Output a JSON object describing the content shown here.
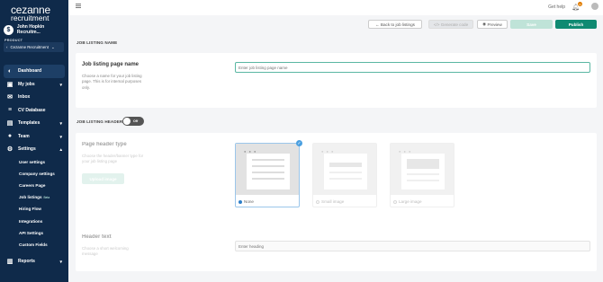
{
  "sidebar": {
    "logo_line1": "cezanne",
    "logo_line2": "recruitment",
    "user_initial": "$",
    "user_name": "John Hopkin Recruitm...",
    "product_label": "PRODUCT",
    "product_value": "Cezanne Recruitment",
    "nav": {
      "dashboard": "Dashboard",
      "my_jobs": "My jobs",
      "inbox": "Inbox",
      "cv_database": "CV Database",
      "templates": "Templates",
      "team": "Team",
      "settings": "Settings",
      "reports": "Reports"
    },
    "settings_sub": {
      "user_settings": "User settings",
      "company_settings": "Company settings",
      "careers_page": "Careers Page",
      "job_listings": "Job listings",
      "job_listings_badge": "Beta",
      "hiring_flow": "Hiring Flow",
      "integrations": "Integrations",
      "api_settings": "API Settings",
      "custom_fields": "Custom Fields"
    }
  },
  "topbar": {
    "get_help": "Get help",
    "notification_count": "N"
  },
  "actions": {
    "back": "Back to job listings",
    "generate": "Generate code",
    "preview": "Preview",
    "save": "Save",
    "publish": "Publish"
  },
  "listing_name": {
    "section_title": "JOB LISTING NAME",
    "field_title": "Job listing page name",
    "field_desc": "Choose a name for your job listing page. This is for internal purposes only.",
    "placeholder": "Enter job listing page name"
  },
  "listing_header": {
    "section_title": "JOB LISTING HEADER",
    "toggle_label": "Off",
    "page_header_type_title": "Page header type",
    "page_header_type_desc": "Choose the header/banner type for your job listing page",
    "upload_button": "Upload image",
    "options": {
      "none": "None",
      "small": "Small image",
      "large": "Large image"
    },
    "selected_option": "None",
    "header_text_title": "Header text",
    "header_text_desc": "Choose a short welcoming message",
    "header_text_placeholder": "Enter heading"
  },
  "colors": {
    "sidebar_bg": "#0f2a4a",
    "primary_green": "#0f8a72",
    "save_disabled": "#bfe3d8",
    "selected_blue": "#4a9fe0"
  }
}
